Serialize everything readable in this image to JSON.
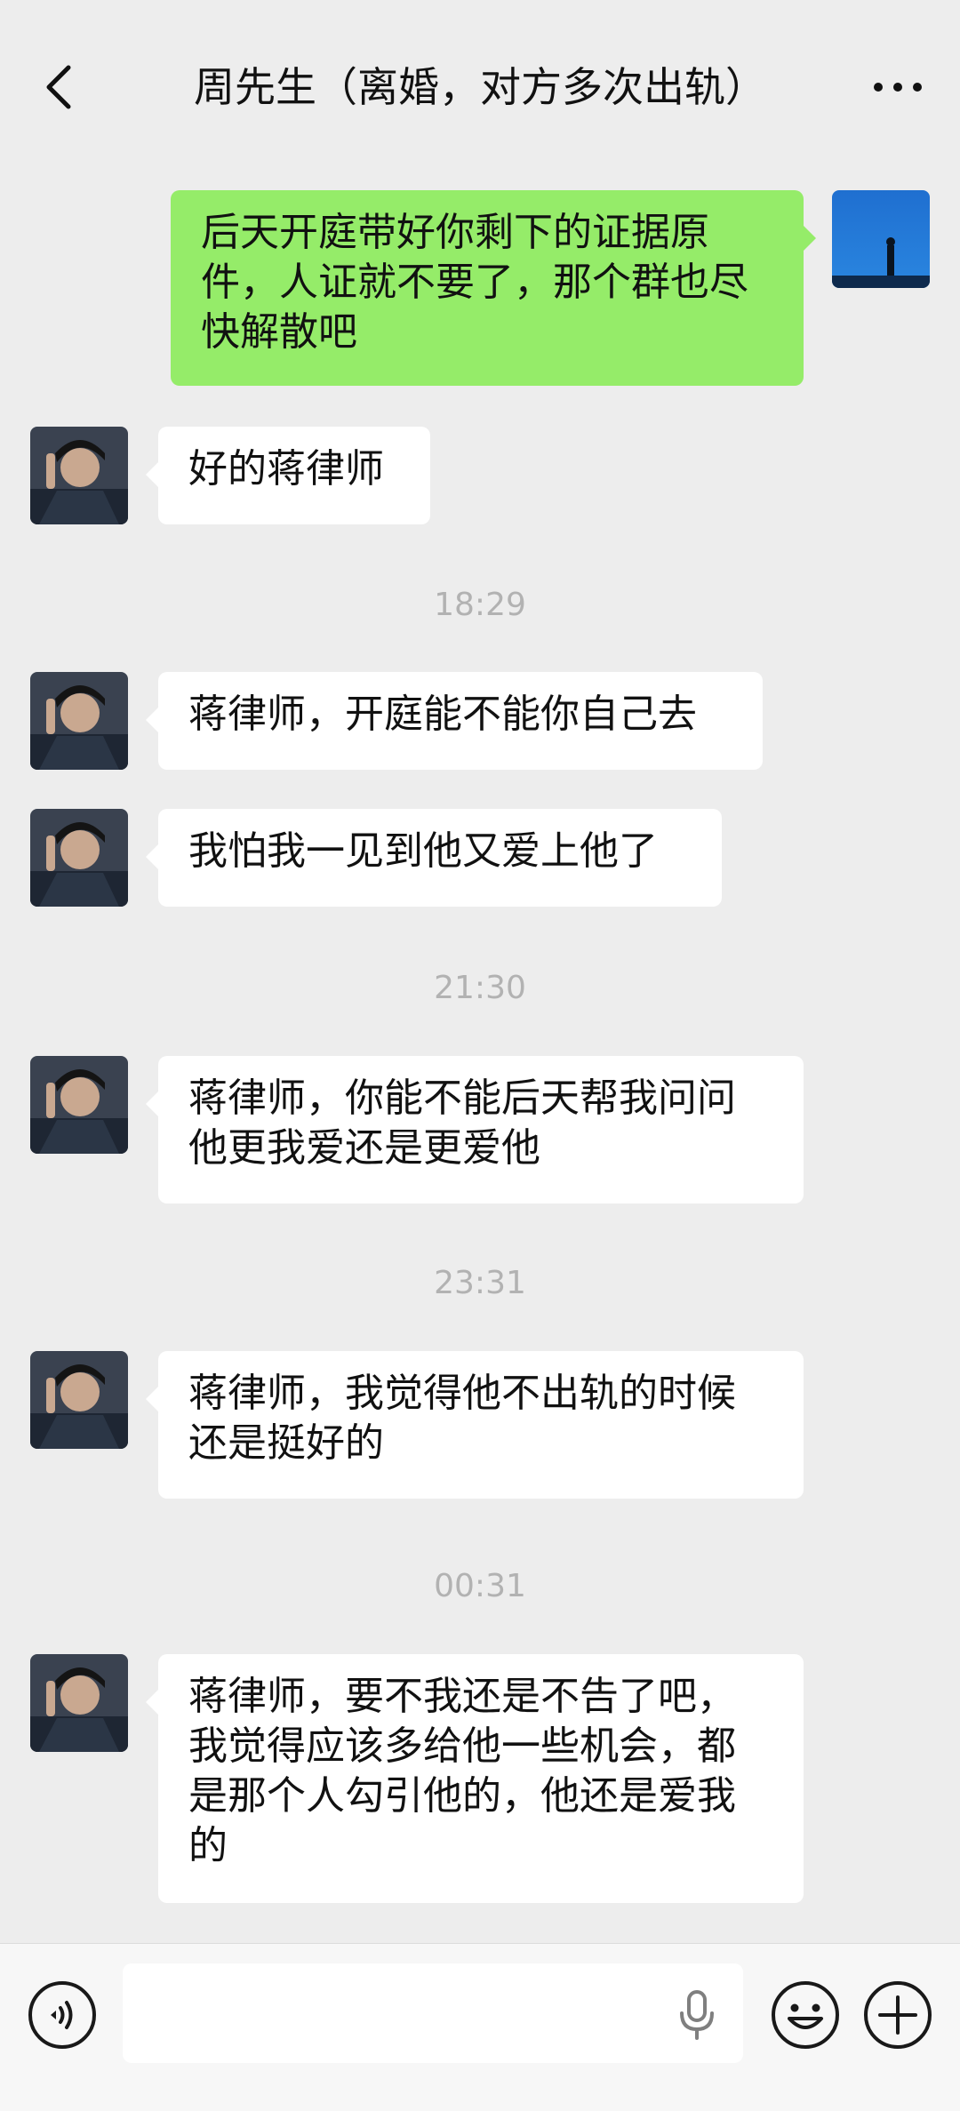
{
  "header": {
    "title": "周先生（离婚，对方多次出轨）",
    "back_icon": "chevron-left-icon",
    "more_icon": "more-horizontal-icon"
  },
  "messages": [
    {
      "side": "out",
      "text": "后天开庭带好你剩下的证据原\n件，人证就不要了，那个群也尽\n快解散吧"
    },
    {
      "side": "in",
      "text": "好的蒋律师"
    },
    {
      "time": "18:29"
    },
    {
      "side": "in",
      "text": "蒋律师，开庭能不能你自己去"
    },
    {
      "side": "in",
      "text": "我怕我一见到他又爱上他了"
    },
    {
      "time": "21:30"
    },
    {
      "side": "in",
      "text": "蒋律师，你能不能后天帮我问问\n他更我爱还是更爱他"
    },
    {
      "time": "23:31"
    },
    {
      "side": "in",
      "text": "蒋律师，我觉得他不出轨的时候\n还是挺好的"
    },
    {
      "time": "00:31"
    },
    {
      "side": "in",
      "text": "蒋律师，要不我还是不告了吧，\n我觉得应该多给他一些机会，都\n是那个人勾引他的，他还是爱我\n的"
    }
  ],
  "input_bar": {
    "placeholder": "",
    "voice_icon": "voice-mode-icon",
    "mic_icon": "microphone-icon",
    "emoji_icon": "emoji-icon",
    "plus_icon": "plus-icon"
  },
  "colors": {
    "background": "#ededed",
    "outgoing_bubble": "#95ec69",
    "incoming_bubble": "#ffffff",
    "timestamp": "#b2b2b2"
  }
}
